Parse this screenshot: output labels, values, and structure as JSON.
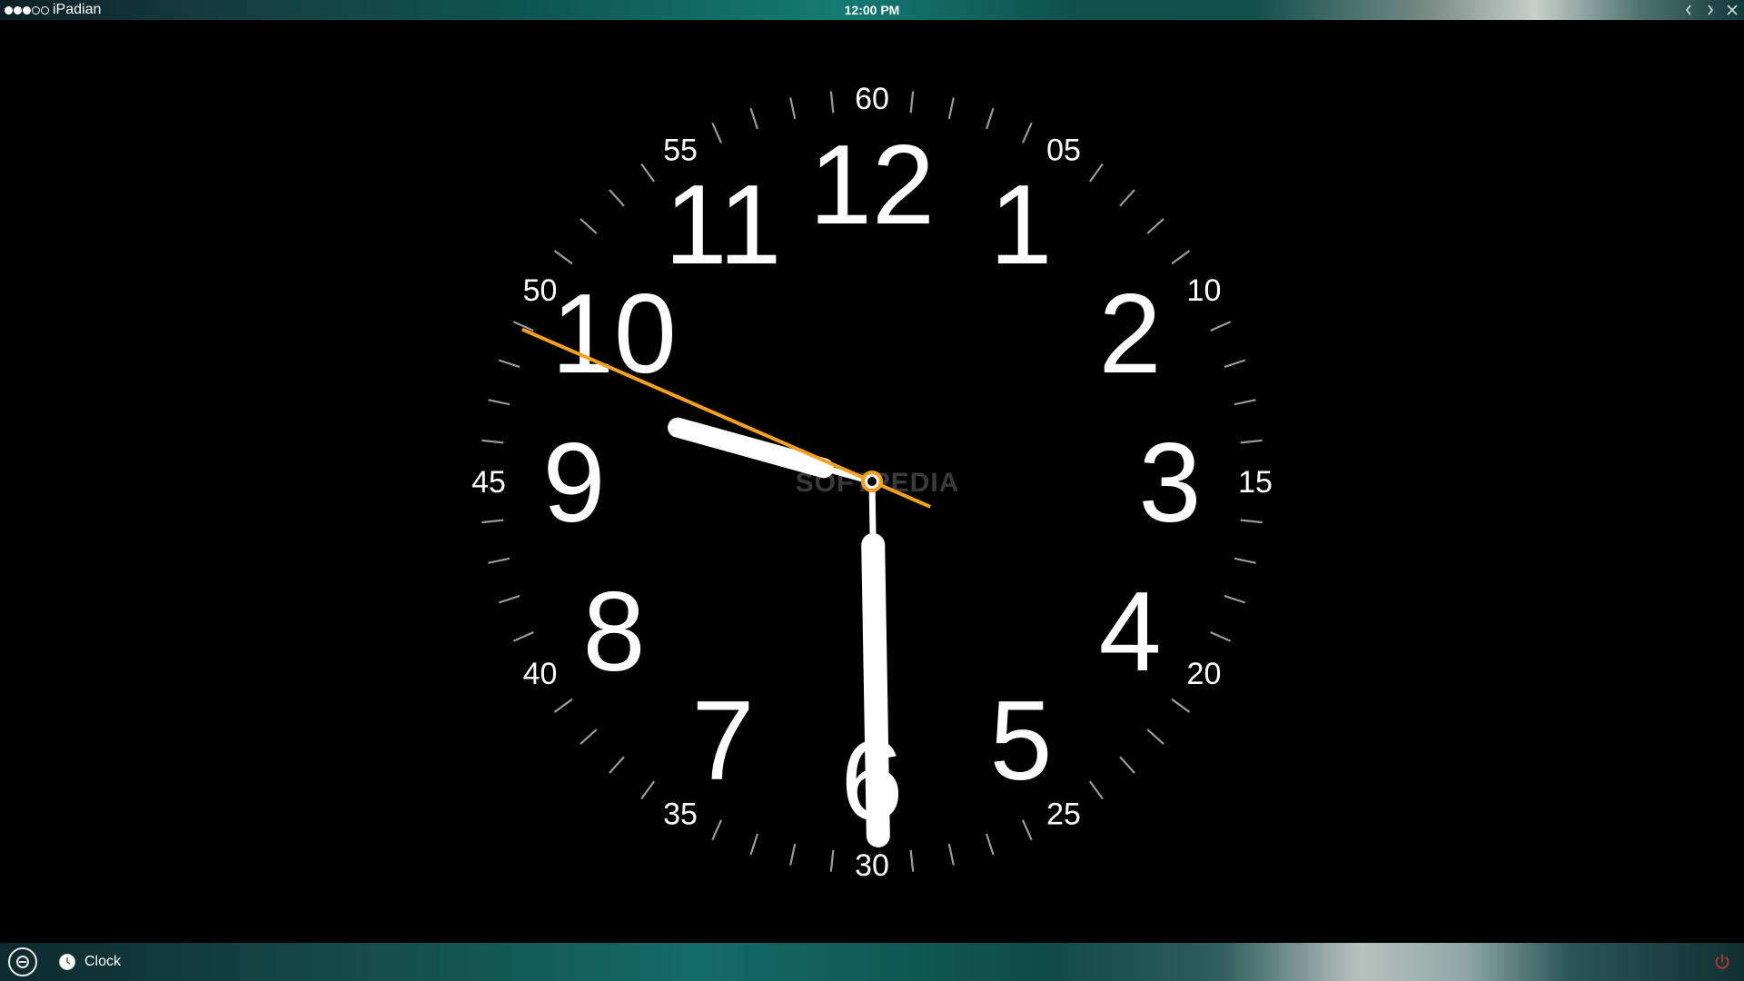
{
  "status_bar": {
    "carrier": "iPadian",
    "time": "12:00 PM",
    "signal_dots_filled": 3,
    "signal_dots_total": 5
  },
  "window_controls": [
    {
      "name": "back-button",
      "icon": "chevron-left-icon"
    },
    {
      "name": "forward-button",
      "icon": "chevron-right-icon"
    },
    {
      "name": "close-button",
      "icon": "close-icon"
    }
  ],
  "clock": {
    "hour_numerals": [
      "12",
      "1",
      "2",
      "3",
      "4",
      "5",
      "6",
      "7",
      "8",
      "9",
      "10",
      "11"
    ],
    "minute_numerals": [
      "60",
      "05",
      "10",
      "15",
      "20",
      "25",
      "30",
      "35",
      "40",
      "45",
      "50",
      "55"
    ],
    "hands": {
      "hour_degrees": 285.5,
      "minute_degrees": 179,
      "second_degrees": 293.5
    },
    "second_hand_color": "#f5a020",
    "watermark": "SOFTPEDIA"
  },
  "taskbar": {
    "start_icon": "ipadian-logo-icon",
    "items": [
      {
        "label": "Clock",
        "icon": "clock-icon"
      }
    ],
    "power_icon": "power-icon",
    "power_color": "#c0392b"
  }
}
